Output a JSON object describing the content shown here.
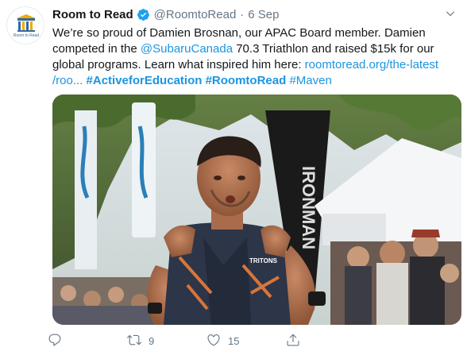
{
  "author": {
    "name": "Room to Read",
    "handle": "@RoomtoRead",
    "separator": "·",
    "time": "6 Sep",
    "avatar_logo_text": "Room to Read"
  },
  "tweet": {
    "line1": "We’re so proud of Damien Brosnan, our APAC Board member. Damien",
    "line2_a": "competed in the ",
    "line2_mention": "@SubaruCanada",
    "line2_b": " 70.3 Triathlon and raised $15k for our",
    "line3_a": "global programs. Learn what inspired him here: ",
    "line3_link": "roomtoread.org/the-latest",
    "line4_link": "/roo...",
    "hashtag1": "#ActiveforEducation",
    "hashtag2": "#RoomtoRead",
    "hashtag3": "#Maven"
  },
  "media": {
    "description": "Triathlete running toward finish line",
    "banner_text": "IRONMAN",
    "jersey_text": "TRITONS"
  },
  "actions": {
    "reply_count": "",
    "retweet_count": "9",
    "like_count": "15"
  },
  "colors": {
    "link": "#1b95e0",
    "muted": "#657786",
    "verified": "#1da1f2"
  }
}
